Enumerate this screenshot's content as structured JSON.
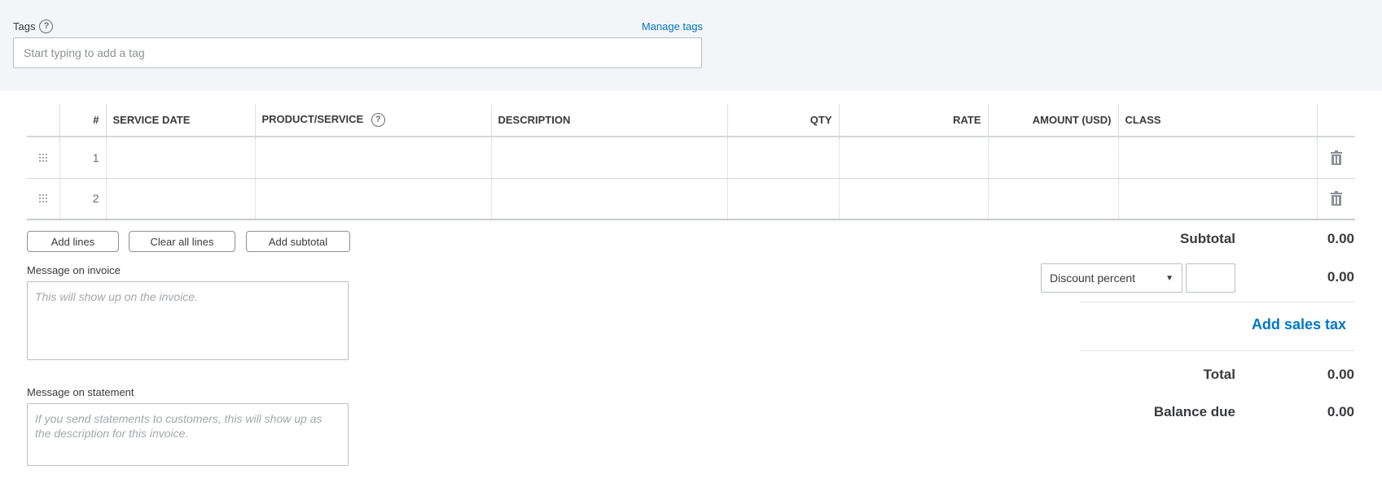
{
  "tags": {
    "label": "Tags",
    "help_icon": "question-circle-icon",
    "manage_link": "Manage tags",
    "input_placeholder": "Start typing to add a tag",
    "input_value": ""
  },
  "line_items": {
    "columns": [
      "",
      "#",
      "SERVICE DATE",
      "PRODUCT/SERVICE",
      "DESCRIPTION",
      "QTY",
      "RATE",
      "AMOUNT (USD)",
      "CLASS",
      ""
    ],
    "product_help_icon": "question-circle-icon",
    "rows": [
      {
        "num": "1",
        "service_date": "",
        "product_service": "",
        "description": "",
        "qty": "",
        "rate": "",
        "amount": "",
        "class": ""
      },
      {
        "num": "2",
        "service_date": "",
        "product_service": "",
        "description": "",
        "qty": "",
        "rate": "",
        "amount": "",
        "class": ""
      }
    ],
    "row_icons": {
      "drag": "drag-handle-icon",
      "delete": "trash-icon"
    }
  },
  "actions": {
    "add_lines": "Add lines",
    "clear_all_lines": "Clear all lines",
    "add_subtotal": "Add subtotal"
  },
  "message_invoice": {
    "label": "Message on invoice",
    "placeholder": "This will show up on the invoice.",
    "value": ""
  },
  "message_statement": {
    "label": "Message on statement",
    "placeholder": "If you send statements to customers, this will show up as the description for this invoice.",
    "value": ""
  },
  "totals": {
    "subtotal_label": "Subtotal",
    "subtotal_value": "0.00",
    "discount_type": "Discount percent",
    "discount_input": "",
    "discount_value": "0.00",
    "add_sales_tax": "Add sales tax",
    "total_label": "Total",
    "total_value": "0.00",
    "balance_due_label": "Balance due",
    "balance_due_value": "0.00"
  },
  "colors": {
    "link": "#0077c5",
    "text": "#393a3d",
    "tags_bg": "#f4f5f8"
  }
}
